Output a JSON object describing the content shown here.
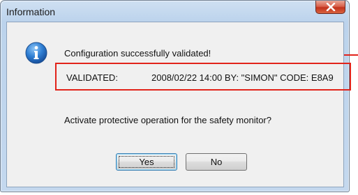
{
  "window": {
    "title": "Information",
    "close_label": "x"
  },
  "message": {
    "icon": "info-icon",
    "title": "Configuration successfully validated!",
    "validation": {
      "label": "VALIDATED:",
      "value": "2008/02/22 14:00 BY: \"SIMON\" CODE: E8A9"
    },
    "question": "Activate protective operation for the safety monitor?"
  },
  "buttons": {
    "yes_label": "Yes",
    "no_label": "No"
  },
  "colors": {
    "highlight": "#e2231a",
    "dialog_background": "#f0f0f0",
    "frame": "#c4d8ee",
    "close_button": "#c2321c"
  }
}
